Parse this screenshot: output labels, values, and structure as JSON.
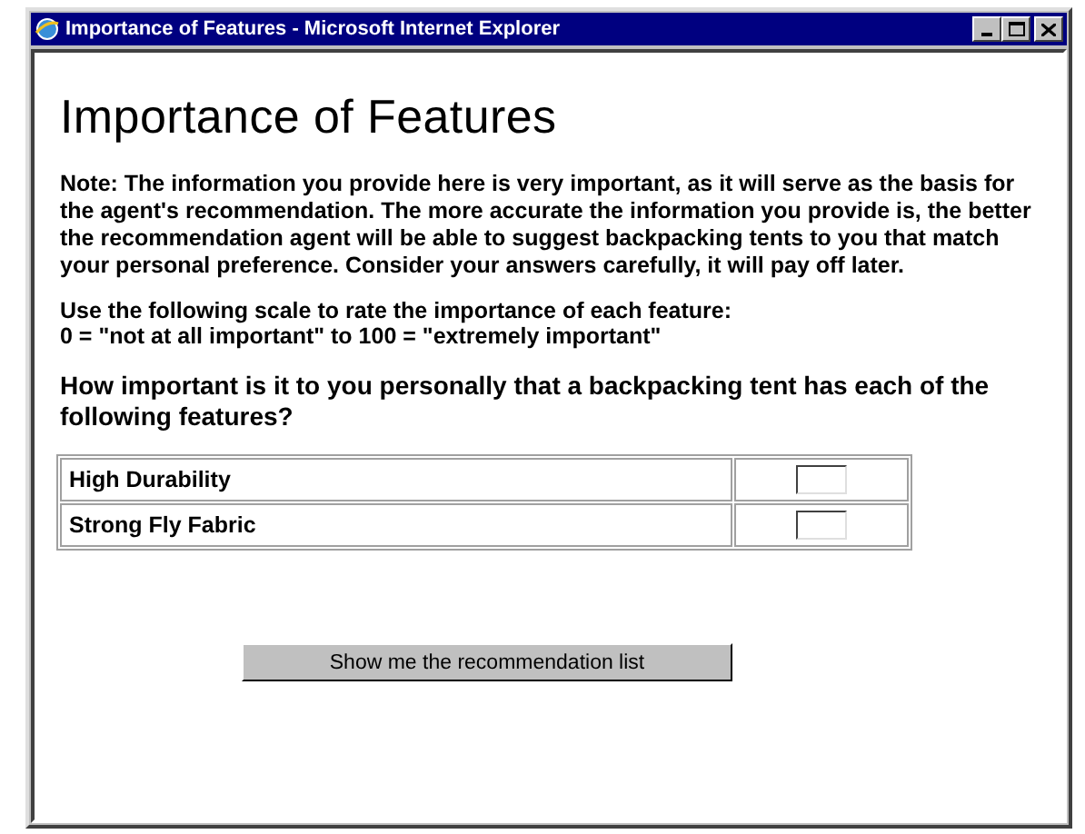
{
  "window": {
    "title": "Importance of Features - Microsoft Internet Explorer"
  },
  "heading": "Importance of Features",
  "note": "Note: The information you provide here is very important, as it will serve as the basis for the agent's recommendation. The more accurate the information you provide is, the better the recommendation agent will be able to suggest backpacking tents to you that match your personal preference. Consider your answers carefully, it will pay off later.",
  "scale": [
    "Use the following scale to rate the importance of each feature:",
    "0 = \"not at all important\" to 100 = \"extremely important\""
  ],
  "question": "How important is it to you personally that a backpacking tent has each of the following features?",
  "features": [
    {
      "name": "High Durability"
    },
    {
      "name": "Strong Fly Fabric"
    }
  ],
  "button": "Show me the recommendation list"
}
